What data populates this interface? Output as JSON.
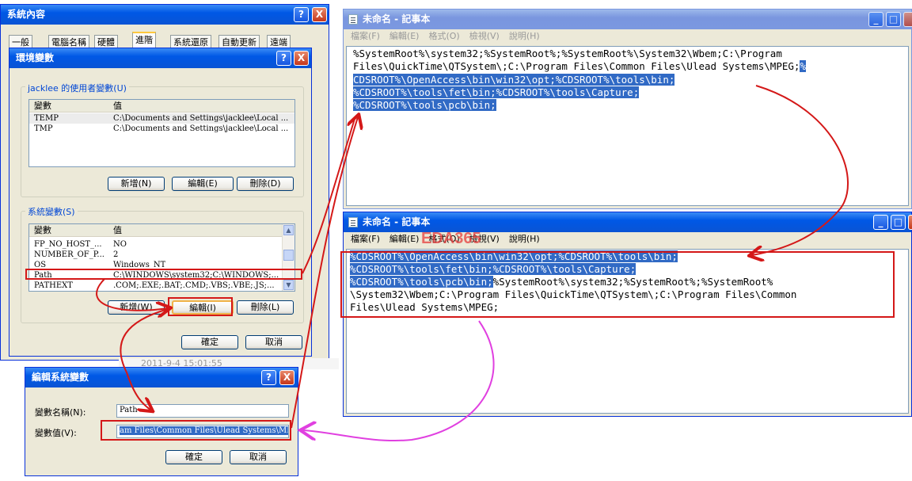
{
  "sysprop": {
    "title": "系統內容",
    "help": "?",
    "close": "X",
    "tabs": [
      "一般",
      "電腦名稱",
      "硬體",
      "進階",
      "系統還原",
      "自動更新",
      "遠端"
    ]
  },
  "envvars": {
    "title": "環境變數",
    "help": "?",
    "close": "X",
    "user_group": "jacklee 的使用者變數(U)",
    "col_var": "變數",
    "col_val": "值",
    "user_rows": [
      {
        "name": "TEMP",
        "value": "C:\\Documents and Settings\\jacklee\\Local ..."
      },
      {
        "name": "TMP",
        "value": "C:\\Documents and Settings\\jacklee\\Local ..."
      }
    ],
    "user_new": "新增(N)",
    "user_edit": "編輯(E)",
    "user_delete": "刪除(D)",
    "sys_group": "系統變數(S)",
    "sys_rows": [
      {
        "name": "FP_NO_HOST_...",
        "value": "NO"
      },
      {
        "name": "NUMBER_OF_P...",
        "value": "2"
      },
      {
        "name": "OS",
        "value": "Windows_NT"
      },
      {
        "name": "Path",
        "value": "C:\\WINDOWS\\system32;C:\\WINDOWS;..."
      },
      {
        "name": "PATHEXT",
        "value": ".COM;.EXE;.BAT;.CMD;.VBS;.VBE;.JS;..."
      }
    ],
    "sys_new": "新增(W)",
    "sys_edit": "編輯(I)",
    "sys_delete": "刪除(L)",
    "ok": "確定",
    "cancel": "取消"
  },
  "behind": {
    "text": "2011-9-4 15:01:55"
  },
  "edit_dialog": {
    "title": "編輯系統變數",
    "help": "?",
    "close": "X",
    "name_label": "變數名稱(N):",
    "name_value": "Path",
    "value_label": "變數值(V):",
    "value_value": "am Files\\Common Files\\Ulead Systems\\MPEG",
    "ok": "確定",
    "cancel": "取消"
  },
  "notepad_top": {
    "title": "未命名 - 記事本",
    "minimize": "_",
    "maximize": "□",
    "menus": [
      "檔案(F)",
      "編輯(E)",
      "格式(O)",
      "檢視(V)",
      "說明(H)"
    ],
    "line1": "%SystemRoot%\\system32;%SystemRoot%;%SystemRoot%\\System32\\Wbem;C:\\Program",
    "line2_plain": "Files\\QuickTime\\QTSystem\\;C:\\Program Files\\Common Files\\Ulead Systems\\MPEG;",
    "line2_sel": "%",
    "line3_sel": "CDSROOT%\\OpenAccess\\bin\\win32\\opt;%CDSROOT%\\tools\\bin;",
    "line4_sel": "%CDSROOT%\\tools\\fet\\bin;%CDSROOT%\\tools\\Capture;",
    "line5_sel": "%CDSROOT%\\tools\\pcb\\bin;"
  },
  "notepad_bottom": {
    "title": "未命名 - 記事本",
    "minimize": "_",
    "maximize": "□",
    "menus": [
      "檔案(F)",
      "編輯(E)",
      "格式(O)",
      "檢視(V)",
      "說明(H)"
    ],
    "watermark": "EDA365",
    "line1_sel": "%CDSROOT%\\OpenAccess\\bin\\win32\\opt;%CDSROOT%\\tools\\bin;",
    "line2_sel": "%CDSROOT%\\tools\\fet\\bin;%CDSROOT%\\tools\\Capture;",
    "line3_sel": "%CDSROOT%\\tools\\pcb\\bin;",
    "line3_plain": "%SystemRoot%\\system32;%SystemRoot%;%SystemRoot%",
    "line4": "\\System32\\Wbem;C:\\Program Files\\QuickTime\\QTSystem\\;C:\\Program Files\\Common",
    "line5": "Files\\Ulead Systems\\MPEG;"
  },
  "colors": {
    "title_active": "#0058e6",
    "selection": "#316ac5",
    "annotation_red": "#d41818",
    "annotation_magenta": "#e040e0"
  }
}
